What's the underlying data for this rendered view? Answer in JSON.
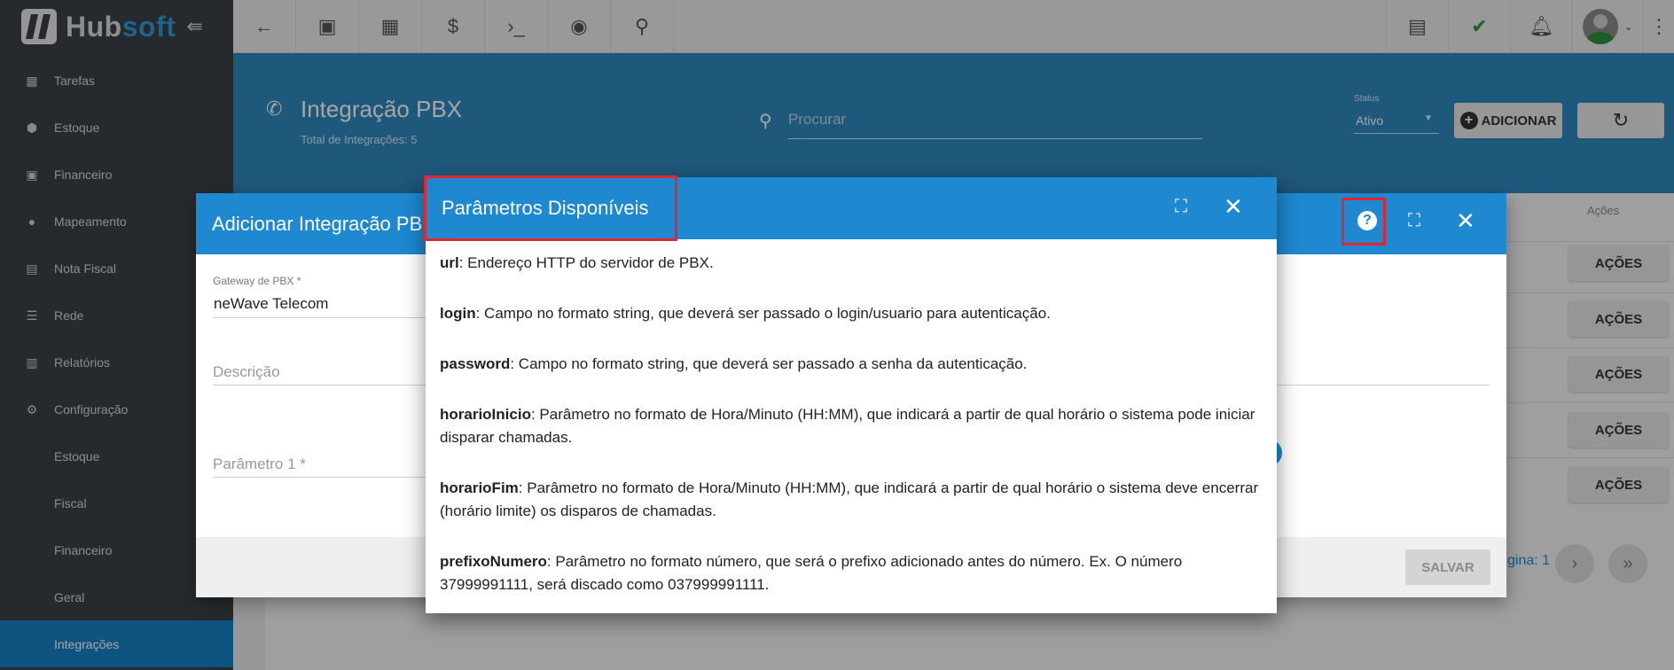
{
  "app": {
    "brand_a": "Hub",
    "brand_b": "soft"
  },
  "sidebar": {
    "items": [
      {
        "label": "Tarefas",
        "icon": "calendar-icon"
      },
      {
        "label": "Estoque",
        "icon": "box-icon"
      },
      {
        "label": "Financeiro",
        "icon": "money-icon"
      },
      {
        "label": "Mapeamento",
        "icon": "map-pin-icon"
      },
      {
        "label": "Nota Fiscal",
        "icon": "receipt-icon"
      },
      {
        "label": "Rede",
        "icon": "server-icon"
      },
      {
        "label": "Relatórios",
        "icon": "report-icon"
      },
      {
        "label": "Configuração",
        "icon": "gear-icon"
      }
    ],
    "sub_items": [
      "Estoque",
      "Fiscal",
      "Financeiro",
      "Geral",
      "Integrações"
    ],
    "active": "Integrações"
  },
  "header": {
    "title": "Integração PBX",
    "subtitle": "Total de Integrações: 5",
    "search_placeholder": "Procurar",
    "status_label": "Status",
    "status_value": "Ativo",
    "add_label": "ADICIONAR"
  },
  "table": {
    "actions_header": "Ações",
    "action_label": "AÇÕES",
    "pagination_label": "gina: 1"
  },
  "dialog_add": {
    "title": "Adicionar Integração PB",
    "gateway_label": "Gateway de PBX *",
    "gateway_value": "neWave Telecom",
    "description_placeholder": "Descrição",
    "param1_placeholder": "Parâmetro 1 *",
    "save_label": "SALVAR"
  },
  "dialog_params": {
    "title": "Parâmetros Disponíveis",
    "params": [
      {
        "name": "url",
        "desc": ": Endereço HTTP do servidor de PBX."
      },
      {
        "name": "login",
        "desc": ": Campo no formato string, que deverá ser passado o login/usuario para autenticação."
      },
      {
        "name": "password",
        "desc": ": Campo no formato string, que deverá ser passado a senha da autenticação."
      },
      {
        "name": "horarioInicio",
        "desc": ": Parâmetro no formato de Hora/Minuto (HH:MM), que indicará a partir de qual horário o sistema pode iniciar disparar chamadas."
      },
      {
        "name": "horarioFim",
        "desc": ": Parâmetro no formato de Hora/Minuto (HH:MM), que indicará a partir de qual horário o sistema deve encerrar (horário limite) os disparos de chamadas."
      },
      {
        "name": "prefixoNumero",
        "desc": ": Parâmetro no formato número, que será o prefixo adicionado antes do número. Ex. O número 37999991111, será discado como 037999991111."
      }
    ]
  },
  "colors": {
    "primary": "#1e88d0",
    "sidebar": "#3b4148",
    "highlight": "#e3262d"
  }
}
